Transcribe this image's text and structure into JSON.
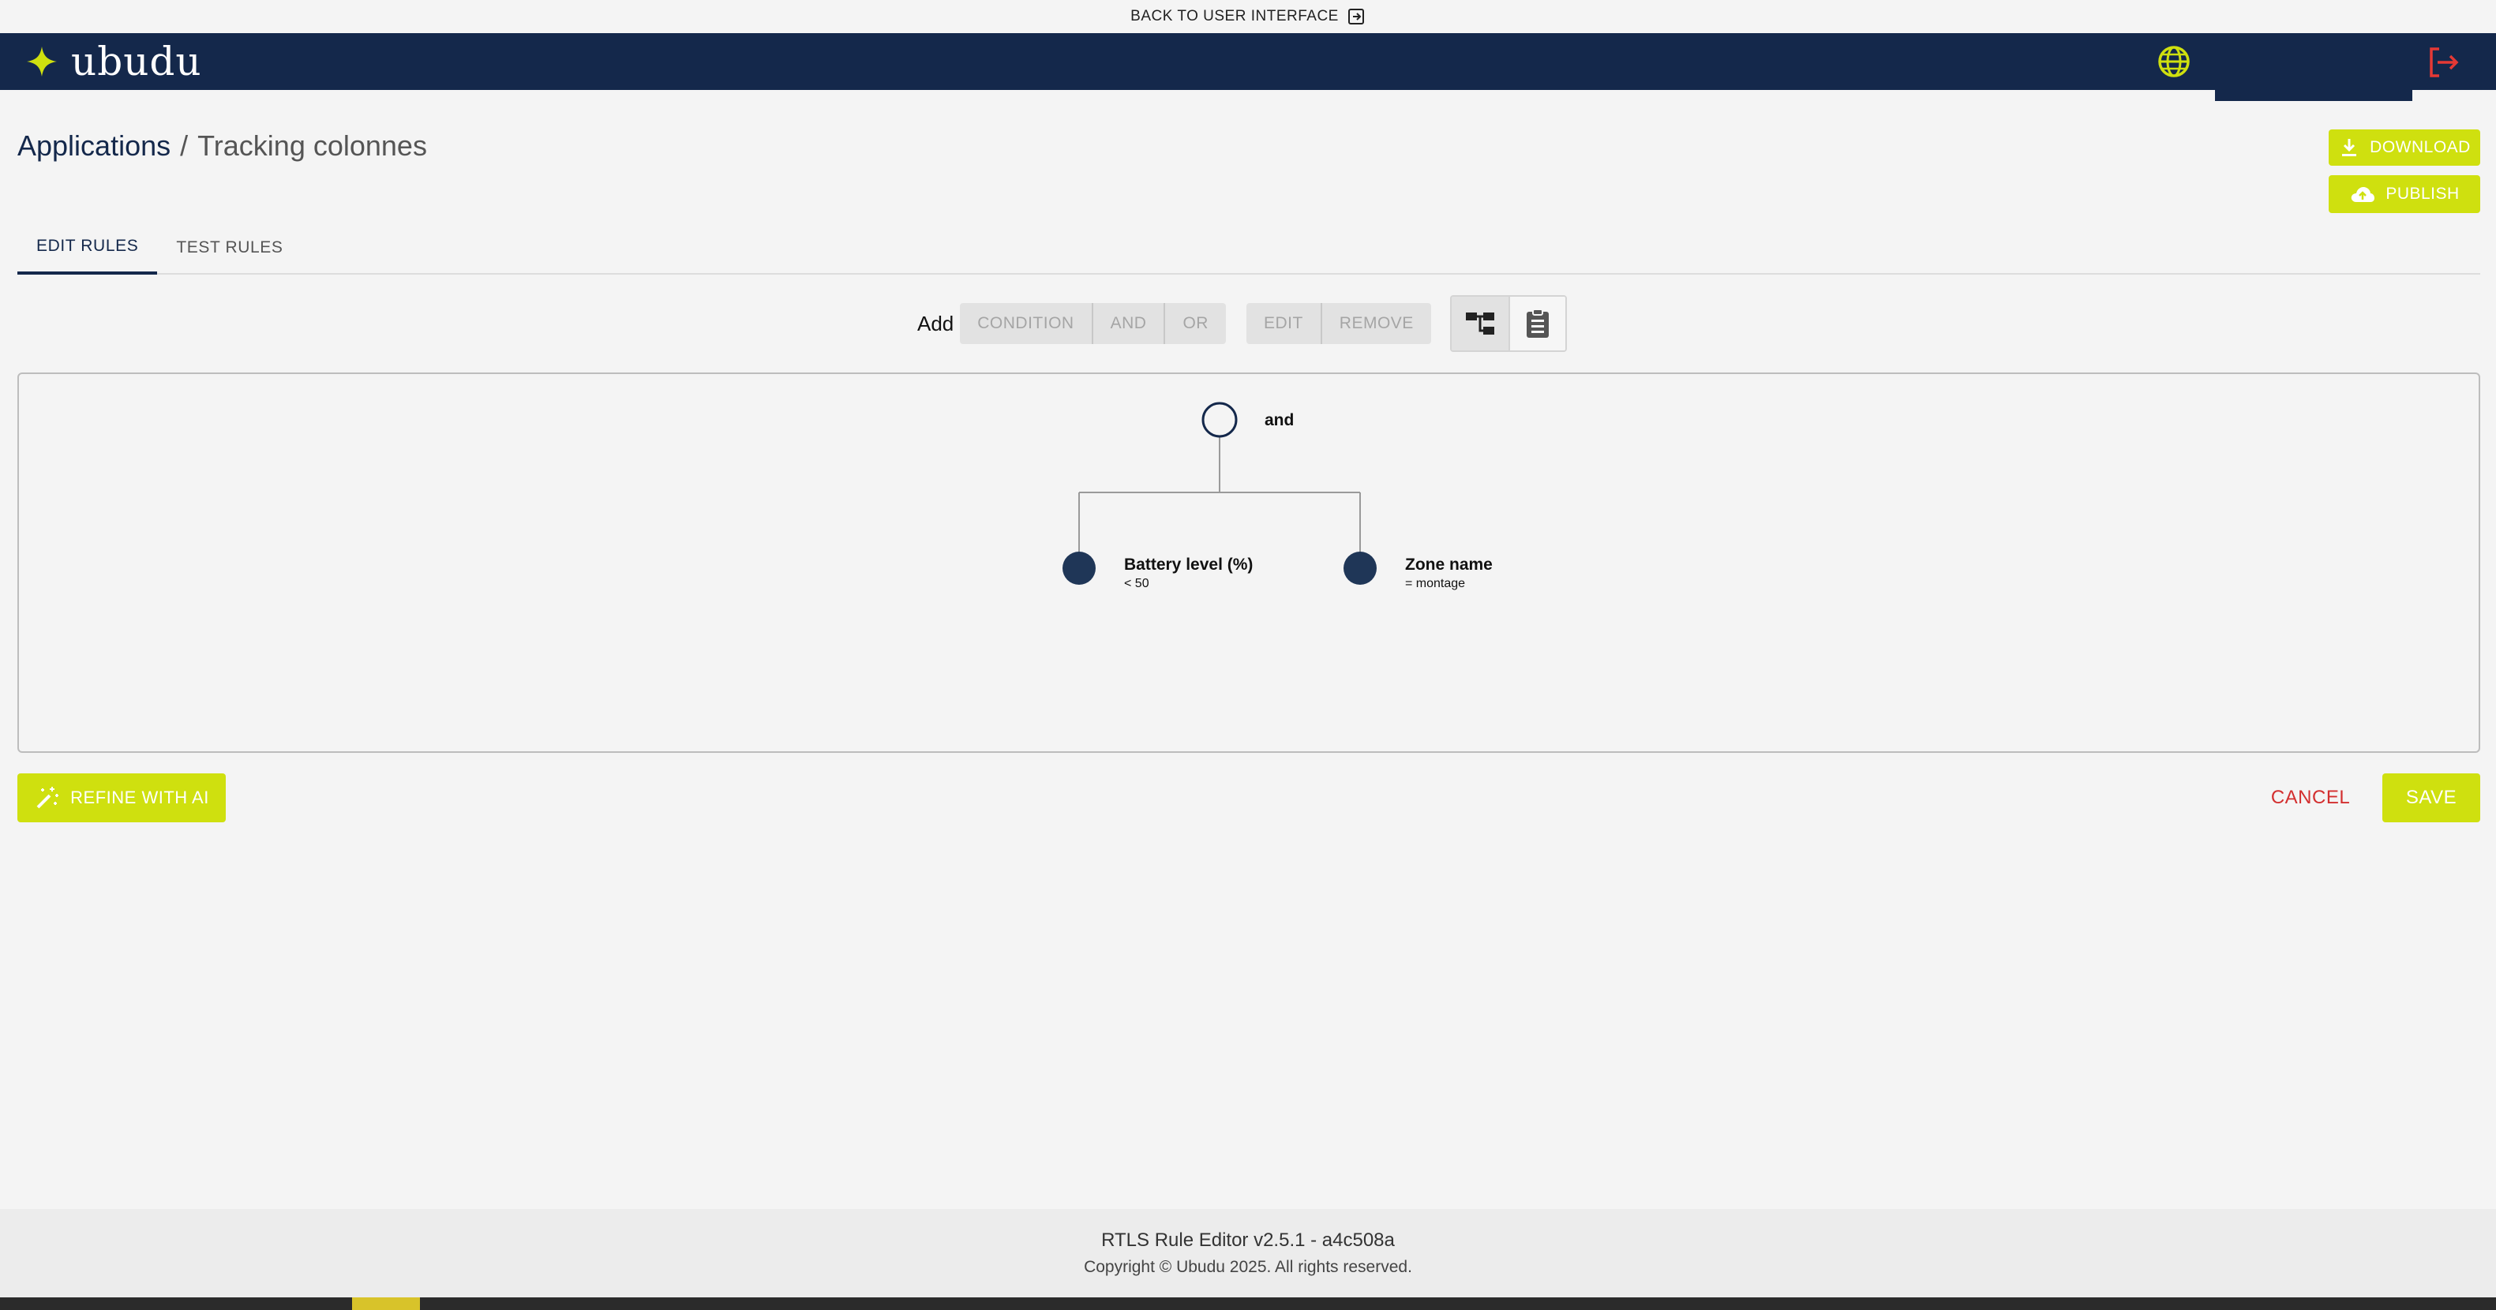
{
  "top_link": {
    "label": "BACK TO USER INTERFACE",
    "icon": "exit-box-icon"
  },
  "header": {
    "brand": "ubudu",
    "brand_color": "#14284b",
    "accent_color": "#cfe00f",
    "globe_icon": "globe-icon",
    "logout_icon": "logout-icon"
  },
  "breadcrumb": {
    "root": "Applications",
    "separator": "/",
    "current": "Tracking colonnes"
  },
  "actions": {
    "download": "DOWNLOAD",
    "publish": "PUBLISH"
  },
  "tabs": [
    {
      "label": "EDIT RULES",
      "active": true
    },
    {
      "label": "TEST RULES",
      "active": false
    }
  ],
  "toolbar": {
    "add_label": "Add",
    "add_buttons": [
      "CONDITION",
      "AND",
      "OR"
    ],
    "edit_buttons": [
      "EDIT",
      "REMOVE"
    ],
    "views": [
      {
        "icon": "tree-view-icon",
        "selected": true
      },
      {
        "icon": "clipboard-list-icon",
        "selected": false
      }
    ]
  },
  "rule_tree": {
    "root": {
      "label": "and"
    },
    "children": [
      {
        "label": "Battery level (%)",
        "sub": "< 50"
      },
      {
        "label": "Zone name",
        "sub": "= montage"
      }
    ]
  },
  "bottom": {
    "refine": "REFINE WITH AI",
    "cancel": "CANCEL",
    "save": "SAVE"
  },
  "footer": {
    "version": "RTLS Rule Editor v2.5.1 - a4c508a",
    "copyright": "Copyright © Ubudu 2025. All rights reserved."
  }
}
